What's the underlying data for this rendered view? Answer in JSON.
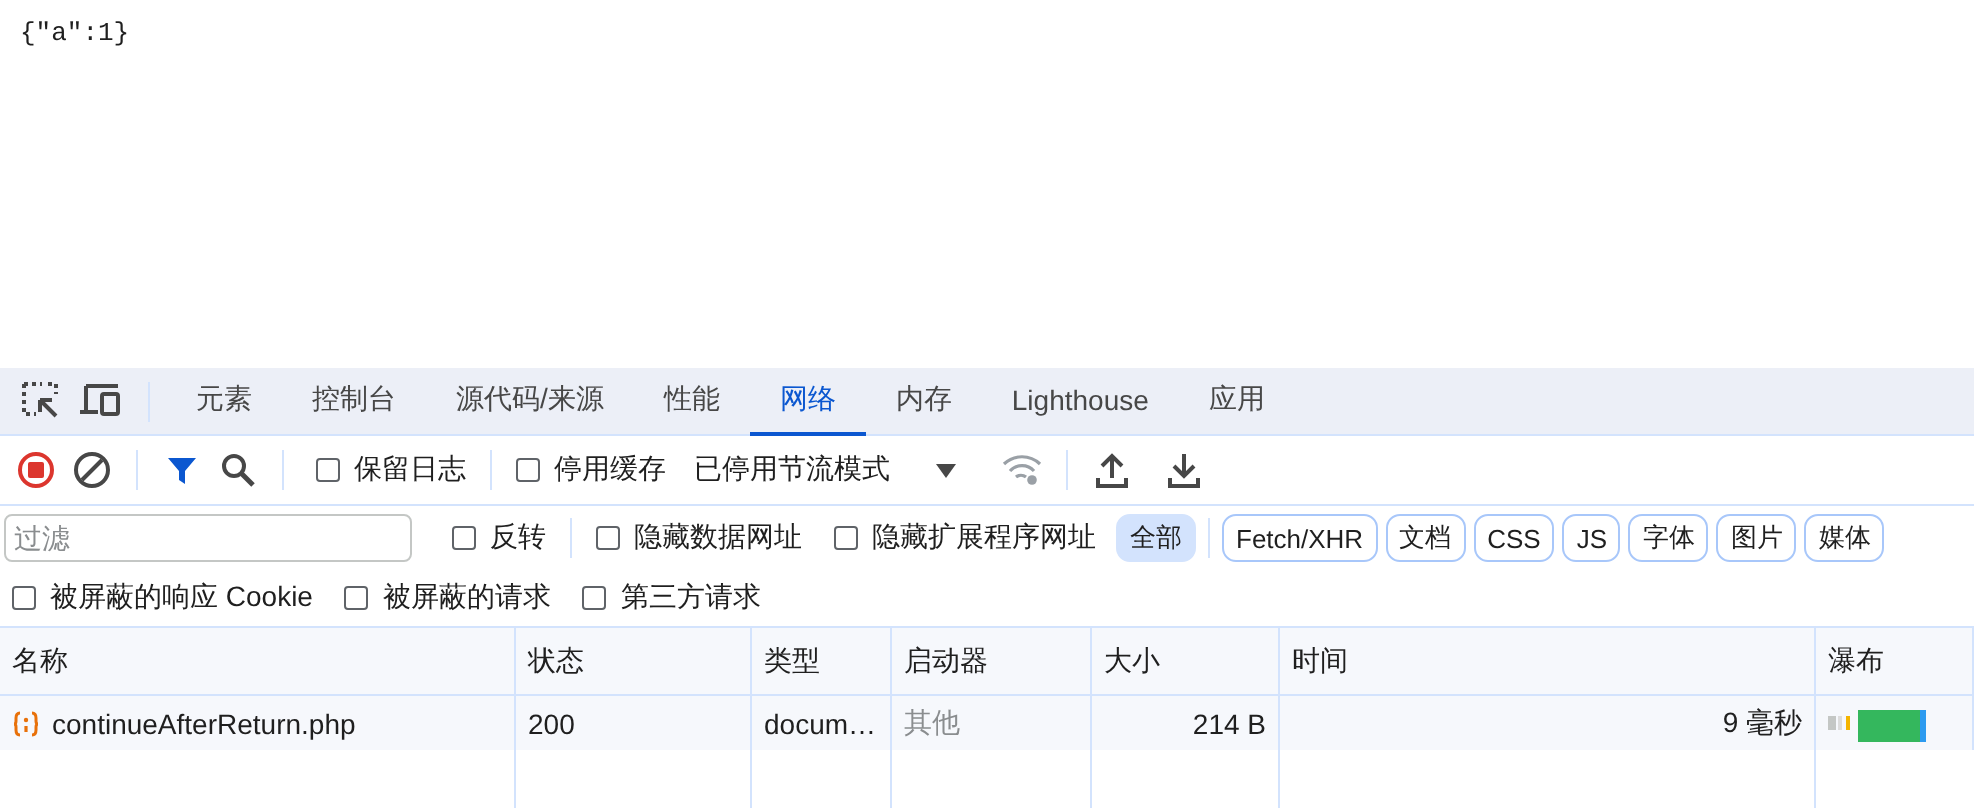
{
  "document": {
    "text": "{\"a\":1}"
  },
  "tabs": [
    {
      "label": "元素",
      "selected": false
    },
    {
      "label": "控制台",
      "selected": false
    },
    {
      "label": "源代码/来源",
      "selected": false
    },
    {
      "label": "性能",
      "selected": false
    },
    {
      "label": "网络",
      "selected": true
    },
    {
      "label": "内存",
      "selected": false
    },
    {
      "label": "Lighthouse",
      "selected": false
    },
    {
      "label": "应用",
      "selected": false
    }
  ],
  "toolbar": {
    "preserve_log": {
      "label": "保留日志",
      "checked": false
    },
    "disable_cache": {
      "label": "停用缓存",
      "checked": false
    },
    "throttling": "已停用节流模式"
  },
  "filter": {
    "placeholder": "过滤",
    "checkboxes": [
      {
        "label": "反转",
        "checked": false
      },
      {
        "label": "隐藏数据网址",
        "checked": false
      },
      {
        "label": "隐藏扩展程序网址",
        "checked": false
      }
    ],
    "types": [
      {
        "label": "全部",
        "selected": true
      },
      {
        "label": "Fetch/XHR",
        "selected": false
      },
      {
        "label": "文档",
        "selected": false
      },
      {
        "label": "CSS",
        "selected": false
      },
      {
        "label": "JS",
        "selected": false
      },
      {
        "label": "字体",
        "selected": false
      },
      {
        "label": "图片",
        "selected": false
      },
      {
        "label": "媒体",
        "selected": false
      }
    ]
  },
  "options": [
    {
      "label": "被屏蔽的响应 Cookie",
      "checked": false
    },
    {
      "label": "被屏蔽的请求",
      "checked": false
    },
    {
      "label": "第三方请求",
      "checked": false
    }
  ],
  "table": {
    "columns": [
      "名称",
      "状态",
      "类型",
      "启动器",
      "大小",
      "时间",
      "瀑布"
    ],
    "rows": [
      {
        "name": "continueAfterReturn.php",
        "status": "200",
        "type": "docum…",
        "initiator": "其他",
        "size": "214 B",
        "time": "9 毫秒"
      }
    ]
  }
}
